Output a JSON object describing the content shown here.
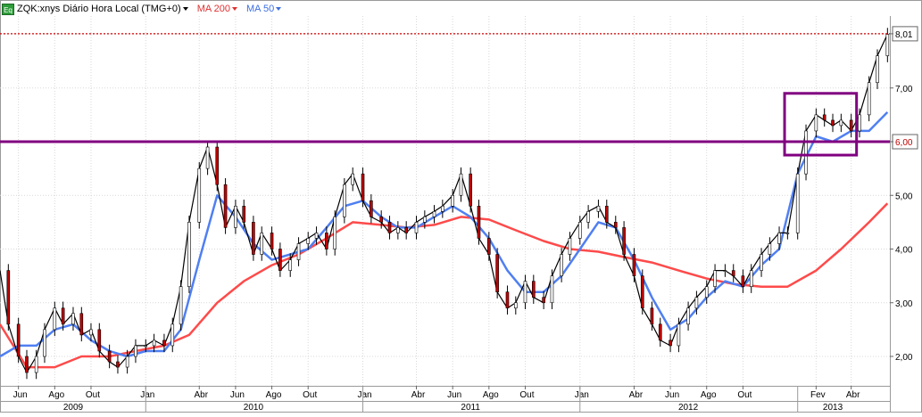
{
  "header": {
    "symbol_label": "ZQK:xnys Diário Hora Local (TMG+0)",
    "eq_badge": "Eq",
    "ma200_label": "MA 200",
    "ma50_label": "MA 50"
  },
  "colors": {
    "price": "#000000",
    "ma200": "#ff4a4a",
    "ma50": "#4f7ff2",
    "resistance_line": "#800080",
    "box": "#800080",
    "dotted_level": "#d00000",
    "grid": "#d8d8d8"
  },
  "chart_data": {
    "type": "line",
    "title": "ZQK:xnys Diário Hora Local (TMG+0)",
    "xlabel": "",
    "ylabel": "",
    "ylim": [
      1.7,
      8.3
    ],
    "grid": true,
    "y_ticks": [
      "2,00",
      "3,00",
      "4,00",
      "5,00",
      "6,00",
      "7,00",
      "8,01"
    ],
    "y_tick_values": [
      2,
      3,
      4,
      5,
      6,
      7,
      8.01
    ],
    "highlighted_ticks": [
      "6,00",
      "8,01"
    ],
    "x_month_ticks": [
      "Jun",
      "Ago",
      "Out",
      "Jan",
      "Abr",
      "Jun",
      "Ago",
      "Out",
      "Jan",
      "Abr",
      "Jun",
      "Ago",
      "Out",
      "Jan",
      "Abr",
      "Jun",
      "Ago",
      "Out",
      "Fev",
      "Abr"
    ],
    "x_month_tick_dates": [
      "2009-06",
      "2009-08",
      "2009-10",
      "2010-01",
      "2010-04",
      "2010-06",
      "2010-08",
      "2010-10",
      "2011-01",
      "2011-04",
      "2011-06",
      "2011-08",
      "2011-10",
      "2012-01",
      "2012-04",
      "2012-06",
      "2012-08",
      "2012-10",
      "2013-02",
      "2013-04"
    ],
    "x_year_labels": [
      "2009",
      "2010",
      "2011",
      "2012",
      "2013"
    ],
    "x_year_centers": [
      "2009-09",
      "2010-07",
      "2011-07",
      "2012-07",
      "2013-03"
    ],
    "x_range": [
      "2009-05-01",
      "2013-06-05"
    ],
    "series": [
      {
        "name": "ZQK:xnys",
        "type": "price",
        "x": [
          "2009-05-01",
          "2009-05-15",
          "2009-06-01",
          "2009-06-15",
          "2009-07-01",
          "2009-07-15",
          "2009-08-01",
          "2009-08-15",
          "2009-09-01",
          "2009-09-15",
          "2009-10-01",
          "2009-10-15",
          "2009-11-01",
          "2009-11-15",
          "2009-12-01",
          "2009-12-15",
          "2010-01-01",
          "2010-01-15",
          "2010-02-01",
          "2010-02-15",
          "2010-03-01",
          "2010-03-15",
          "2010-04-01",
          "2010-04-15",
          "2010-05-01",
          "2010-05-15",
          "2010-06-01",
          "2010-06-15",
          "2010-07-01",
          "2010-07-15",
          "2010-08-01",
          "2010-08-15",
          "2010-09-01",
          "2010-09-15",
          "2010-10-01",
          "2010-10-15",
          "2010-11-01",
          "2010-11-15",
          "2010-12-01",
          "2010-12-15",
          "2011-01-01",
          "2011-01-15",
          "2011-02-01",
          "2011-02-15",
          "2011-03-01",
          "2011-03-15",
          "2011-04-01",
          "2011-04-15",
          "2011-05-01",
          "2011-05-15",
          "2011-06-01",
          "2011-06-15",
          "2011-07-01",
          "2011-07-15",
          "2011-08-01",
          "2011-08-15",
          "2011-09-01",
          "2011-09-15",
          "2011-10-01",
          "2011-10-15",
          "2011-11-01",
          "2011-11-15",
          "2011-12-01",
          "2011-12-15",
          "2012-01-01",
          "2012-01-15",
          "2012-02-01",
          "2012-02-15",
          "2012-03-01",
          "2012-03-15",
          "2012-04-01",
          "2012-04-15",
          "2012-05-01",
          "2012-05-15",
          "2012-06-01",
          "2012-06-15",
          "2012-07-01",
          "2012-07-15",
          "2012-08-01",
          "2012-08-15",
          "2012-09-01",
          "2012-09-15",
          "2012-10-01",
          "2012-10-15",
          "2012-11-01",
          "2012-11-15",
          "2012-12-01",
          "2012-12-15",
          "2013-01-01",
          "2013-01-15",
          "2013-02-01",
          "2013-02-15",
          "2013-03-01",
          "2013-03-15",
          "2013-04-01",
          "2013-04-15",
          "2013-05-01",
          "2013-05-15",
          "2013-06-01"
        ],
        "values": [
          3.6,
          2.6,
          2.0,
          1.7,
          2.0,
          2.5,
          2.9,
          2.6,
          2.8,
          2.4,
          2.5,
          2.1,
          1.9,
          1.8,
          2.0,
          2.2,
          2.2,
          2.3,
          2.2,
          2.6,
          3.3,
          4.5,
          5.5,
          5.9,
          5.2,
          4.4,
          4.8,
          4.5,
          3.9,
          4.3,
          4.0,
          3.6,
          3.8,
          4.1,
          4.2,
          4.3,
          4.0,
          4.6,
          5.2,
          5.4,
          4.9,
          4.6,
          4.5,
          4.3,
          4.4,
          4.3,
          4.5,
          4.6,
          4.7,
          4.8,
          5.0,
          5.4,
          4.8,
          4.2,
          3.9,
          3.2,
          2.9,
          3.0,
          3.4,
          3.1,
          3.0,
          3.5,
          3.9,
          4.2,
          4.5,
          4.7,
          4.8,
          4.5,
          4.4,
          3.9,
          3.5,
          2.9,
          2.6,
          2.3,
          2.2,
          2.6,
          2.9,
          3.1,
          3.3,
          3.6,
          3.6,
          3.5,
          3.3,
          3.6,
          3.9,
          4.1,
          4.3,
          4.3,
          5.4,
          6.2,
          6.5,
          6.4,
          6.3,
          6.4,
          6.2,
          6.5,
          7.1,
          7.6,
          8.0
        ]
      },
      {
        "name": "MA 200",
        "type": "ma",
        "x": [
          "2009-05-01",
          "2009-06-15",
          "2009-08-01",
          "2009-09-15",
          "2009-11-01",
          "2009-12-15",
          "2010-02-01",
          "2010-03-15",
          "2010-05-01",
          "2010-06-15",
          "2010-08-01",
          "2010-09-15",
          "2010-11-01",
          "2010-12-15",
          "2011-02-01",
          "2011-03-15",
          "2011-05-01",
          "2011-06-15",
          "2011-08-01",
          "2011-09-15",
          "2011-11-01",
          "2011-12-15",
          "2012-02-01",
          "2012-03-15",
          "2012-05-01",
          "2012-06-15",
          "2012-08-01",
          "2012-09-15",
          "2012-11-01",
          "2012-12-15",
          "2013-02-01",
          "2013-03-15",
          "2013-05-01",
          "2013-06-01"
        ],
        "values": [
          2.6,
          1.8,
          1.8,
          2.0,
          2.0,
          2.1,
          2.2,
          2.4,
          3.0,
          3.4,
          3.7,
          3.9,
          4.2,
          4.5,
          4.45,
          4.4,
          4.45,
          4.6,
          4.55,
          4.35,
          4.15,
          4.0,
          3.95,
          3.85,
          3.75,
          3.6,
          3.45,
          3.35,
          3.3,
          3.3,
          3.6,
          4.0,
          4.5,
          4.85
        ]
      },
      {
        "name": "MA 50",
        "type": "ma",
        "x": [
          "2009-05-01",
          "2009-06-01",
          "2009-07-01",
          "2009-08-01",
          "2009-09-01",
          "2009-10-01",
          "2009-11-01",
          "2009-12-01",
          "2010-01-01",
          "2010-02-01",
          "2010-03-01",
          "2010-04-01",
          "2010-05-01",
          "2010-06-01",
          "2010-07-01",
          "2010-08-01",
          "2010-09-01",
          "2010-10-01",
          "2010-11-01",
          "2010-12-01",
          "2011-01-01",
          "2011-02-01",
          "2011-03-01",
          "2011-04-01",
          "2011-05-01",
          "2011-06-01",
          "2011-07-01",
          "2011-08-01",
          "2011-09-01",
          "2011-10-01",
          "2011-11-01",
          "2011-12-01",
          "2012-01-01",
          "2012-02-01",
          "2012-03-01",
          "2012-04-01",
          "2012-05-01",
          "2012-06-01",
          "2012-07-01",
          "2012-08-01",
          "2012-09-01",
          "2012-10-01",
          "2012-11-01",
          "2012-12-01",
          "2013-01-01",
          "2013-02-01",
          "2013-03-01",
          "2013-04-01",
          "2013-05-01",
          "2013-06-01"
        ],
        "values": [
          2.0,
          2.2,
          2.2,
          2.5,
          2.6,
          2.3,
          2.1,
          2.0,
          2.1,
          2.1,
          2.5,
          3.8,
          5.0,
          4.6,
          4.1,
          3.8,
          3.9,
          4.0,
          4.4,
          4.8,
          4.9,
          4.6,
          4.4,
          4.4,
          4.6,
          4.8,
          4.6,
          4.2,
          3.6,
          3.2,
          3.2,
          3.5,
          4.0,
          4.5,
          4.4,
          3.8,
          3.1,
          2.5,
          2.7,
          3.1,
          3.4,
          3.3,
          3.7,
          4.0,
          5.4,
          6.1,
          6.0,
          6.2,
          6.2,
          6.55
        ]
      }
    ],
    "annotations": [
      {
        "type": "hline",
        "name": "resistance-line",
        "y": 6.0
      },
      {
        "type": "hline",
        "name": "dotted-level-line",
        "y": 8.01,
        "style": "dotted"
      },
      {
        "type": "box",
        "name": "consolidation-box",
        "x_start": "2012-12-10",
        "x_end": "2013-04-10",
        "y_low": 5.75,
        "y_high": 6.9
      }
    ]
  }
}
